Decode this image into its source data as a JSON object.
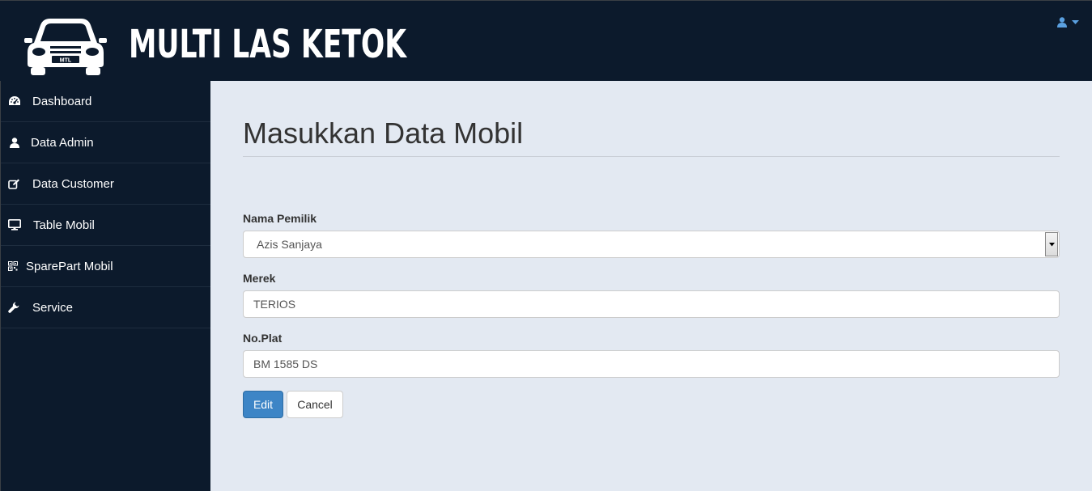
{
  "header": {
    "brand": "MULTI LAS KETOK",
    "logo_plate": "MTL",
    "user_icon": "user-icon",
    "caret_icon": "caret-down-icon"
  },
  "sidebar": {
    "items": [
      {
        "label": "Dashboard",
        "icon": "dashboard-icon"
      },
      {
        "label": "Data Admin",
        "icon": "user-icon"
      },
      {
        "label": "Data Customer",
        "icon": "edit-icon"
      },
      {
        "label": "Table Mobil",
        "icon": "desktop-icon"
      },
      {
        "label": "SparePart Mobil",
        "icon": "qrcode-icon"
      },
      {
        "label": "Service",
        "icon": "wrench-icon"
      }
    ]
  },
  "main": {
    "title": "Masukkan Data Mobil",
    "form": {
      "owner_label": "Nama Pemilik",
      "owner_value": "Azis Sanjaya",
      "brand_label": "Merek",
      "brand_value": "TERIOS",
      "plate_label": "No.Plat",
      "plate_value": "BM 1585 DS"
    },
    "buttons": {
      "edit": "Edit",
      "cancel": "Cancel"
    }
  },
  "colors": {
    "nav_bg": "#0c1a2c",
    "content_bg": "#e3e9f2",
    "primary": "#3d85c6",
    "user_icon": "#5aa0e0"
  }
}
